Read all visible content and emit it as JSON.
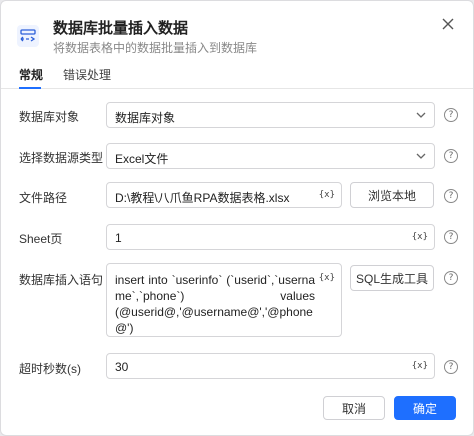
{
  "dialog": {
    "title": "数据库批量插入数据",
    "subtitle": "将数据表格中的数据批量插入到数据库",
    "close_icon": "close-icon"
  },
  "tabs": [
    {
      "label": "常规",
      "active": true
    },
    {
      "label": "错误处理",
      "active": false
    }
  ],
  "form": {
    "db_object": {
      "label": "数据库对象",
      "value": "数据库对象"
    },
    "source_type": {
      "label": "选择数据源类型",
      "value": "Excel文件"
    },
    "file_path": {
      "label": "文件路径",
      "value": "D:\\教程\\八爪鱼RPA数据表格.xlsx",
      "button": "浏览本地"
    },
    "sheet": {
      "label": "Sheet页",
      "value": "1"
    },
    "insert_sql": {
      "label": "数据库插入语句",
      "line1": "insert into `userinfo` (`userid`,`username`,`phone`) values",
      "line2": "(@userid@,'@username@','@phone@')",
      "button": "SQL生成工具"
    },
    "timeout": {
      "label": "超时秒数(s)",
      "value": "30"
    }
  },
  "variable_icon_text": "{x}",
  "help_icon_text": "?",
  "footer": {
    "cancel": "取消",
    "confirm": "确定"
  },
  "colors": {
    "primary": "#1e6fff",
    "border": "#d5d5d8",
    "muted": "#888888"
  }
}
